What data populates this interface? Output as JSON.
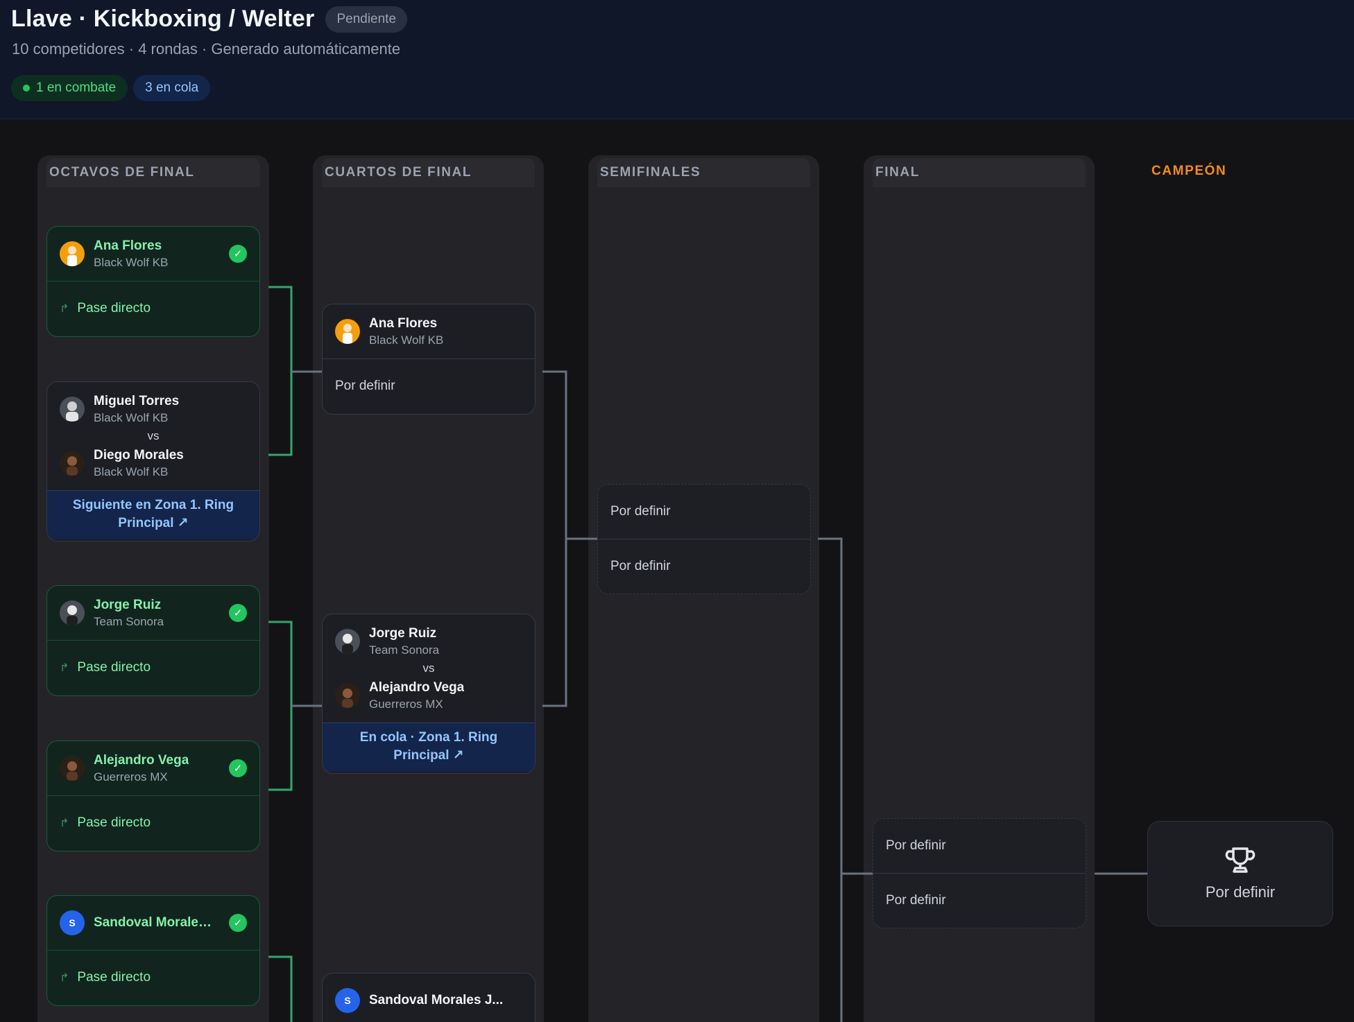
{
  "header": {
    "title": "Llave · Kickboxing / Welter",
    "status": "Pendiente",
    "subtitle": "10 competidores · 4 rondas · Generado automáticamente",
    "live_pill": "1 en combate",
    "queue_pill": "3 en cola"
  },
  "rounds": {
    "r1": "OCTAVOS DE FINAL",
    "r2": "CUARTOS DE FINAL",
    "r3": "SEMIFINALES",
    "r4": "FINAL",
    "champion": "CAMPEÓN"
  },
  "octavos": {
    "m1": {
      "name": "Ana Flores",
      "club": "Black Wolf KB",
      "bye": "Pase directo"
    },
    "m2": {
      "a_name": "Miguel Torres",
      "a_club": "Black Wolf KB",
      "vs": "vs",
      "b_name": "Diego Morales",
      "b_club": "Black Wolf KB",
      "note": "Siguiente en Zona 1. Ring Principal ↗"
    },
    "m3": {
      "name": "Jorge Ruiz",
      "club": "Team Sonora",
      "bye": "Pase directo"
    },
    "m4": {
      "name": "Alejandro Vega",
      "club": "Guerreros MX",
      "bye": "Pase directo"
    },
    "m5": {
      "name": "Sandoval Morales J...",
      "initial": "S",
      "bye": "Pase directo"
    }
  },
  "cuartos": {
    "m1": {
      "name": "Ana Flores",
      "club": "Black Wolf KB",
      "tbd": "Por definir"
    },
    "m2": {
      "a_name": "Jorge Ruiz",
      "a_club": "Team Sonora",
      "vs": "vs",
      "b_name": "Alejandro Vega",
      "b_club": "Guerreros MX",
      "note": "En cola · Zona 1. Ring Principal ↗"
    },
    "m3": {
      "name": "Sandoval Morales J...",
      "initial": "S"
    }
  },
  "semis": {
    "m1": {
      "a": "Por definir",
      "b": "Por definir"
    }
  },
  "final": {
    "m1": {
      "a": "Por definir",
      "b": "Por definir"
    }
  },
  "champion": {
    "text": "Por definir"
  },
  "colors": {
    "accent_green": "#22c55e",
    "accent_blue": "#93c5fd",
    "champion_orange": "#f28c1c"
  }
}
